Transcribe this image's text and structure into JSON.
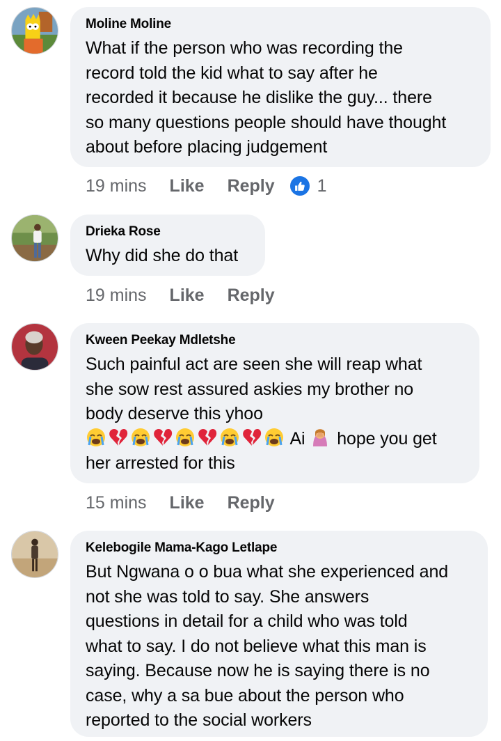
{
  "comments": [
    {
      "author": "Moline Moline",
      "lines": [
        "What if the person who was recording the",
        "record told the kid what to say after he",
        "recorded it because he dislike the guy... there",
        "so many questions people should have thought",
        "about before placing judgement"
      ],
      "time": "19 mins",
      "like_label": "Like",
      "reply_label": "Reply",
      "reaction_count": "1",
      "avatar_icon": "cartoon-character-avatar"
    },
    {
      "author": "Drieka Rose",
      "lines": [
        "Why did she do that"
      ],
      "time": "19 mins",
      "like_label": "Like",
      "reply_label": "Reply",
      "avatar_icon": "person-photo-avatar"
    },
    {
      "author": "Kween Peekay Mdletshe",
      "lines": [
        "Such painful act are seen she will reap what",
        "she sow rest assured askies my brother no",
        "body deserve this yhoo"
      ],
      "emoji_sequence": [
        "crying-face-emoji",
        "broken-heart-emoji",
        "crying-face-emoji",
        "broken-heart-emoji",
        "crying-face-emoji",
        "broken-heart-emoji",
        "crying-face-emoji",
        "broken-heart-emoji",
        "crying-face-emoji"
      ],
      "emoji_text_after": "Ai",
      "facepalm_emoji": "woman-facepalming-emoji",
      "emoji_text_end": "hope you get",
      "last_line": "her arrested for this",
      "time": "15 mins",
      "like_label": "Like",
      "reply_label": "Reply",
      "avatar_icon": "person-photo-avatar"
    },
    {
      "author": "Kelebogile Mama-Kago Letlape",
      "lines": [
        "But Ngwana o o bua what she experienced and",
        "not she was told to say.  She answers",
        "questions in detail for a child who was told",
        "what to say.  I do not believe what this man is",
        "saying.  Because now he is saying there is no",
        "case, why a sa bue about the person who",
        "reported to the social workers"
      ],
      "avatar_icon": "person-photo-avatar"
    }
  ],
  "colors": {
    "bubble": "#f0f2f5",
    "meta_text": "#65676b",
    "like_blue": "#1b74e4"
  }
}
